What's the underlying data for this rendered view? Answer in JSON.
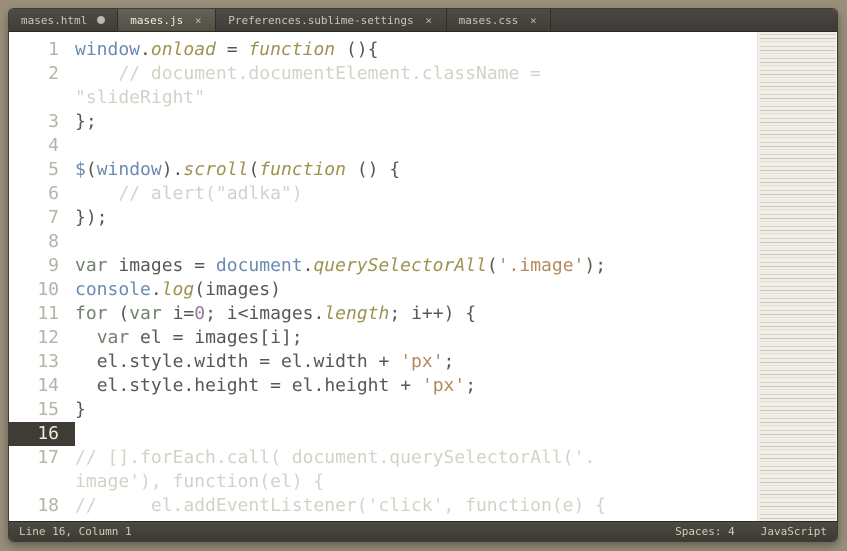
{
  "tabs": [
    {
      "label": "mases.html",
      "dirty": true,
      "active": false
    },
    {
      "label": "mases.js",
      "dirty": false,
      "active": true
    },
    {
      "label": "Preferences.sublime-settings",
      "dirty": false,
      "active": false
    },
    {
      "label": "mases.css",
      "dirty": false,
      "active": false
    }
  ],
  "active_line": 16,
  "status": {
    "left": "Line 16, Column 1",
    "spaces": "Spaces: 4",
    "syntax": "JavaScript"
  },
  "code": {
    "lines": [
      {
        "n": 1,
        "tokens": [
          [
            "c-builtin",
            "window"
          ],
          [
            "c-op",
            "."
          ],
          [
            "c-func",
            "onload"
          ],
          [
            "c-op",
            " = "
          ],
          [
            "c-func",
            "function"
          ],
          [
            "c-op",
            " "
          ],
          [
            "c-op",
            "()"
          ],
          [
            "c-op",
            "{"
          ]
        ]
      },
      {
        "n": 2,
        "tokens": [
          [
            "c-op",
            "    "
          ],
          [
            "c-dim",
            "// document.documentElement.className = "
          ]
        ],
        "wrap": [
          [
            "c-dim",
            "\"slideRight\""
          ]
        ]
      },
      {
        "n": 3,
        "tokens": [
          [
            "c-op",
            "};"
          ]
        ]
      },
      {
        "n": 4,
        "tokens": [
          [
            "c-op",
            ""
          ]
        ]
      },
      {
        "n": 5,
        "tokens": [
          [
            "c-builtin",
            "$"
          ],
          [
            "c-op",
            "("
          ],
          [
            "c-builtin",
            "window"
          ],
          [
            "c-op",
            ")."
          ],
          [
            "c-func",
            "scroll"
          ],
          [
            "c-op",
            "("
          ],
          [
            "c-func",
            "function"
          ],
          [
            "c-op",
            " () {"
          ]
        ]
      },
      {
        "n": 6,
        "tokens": [
          [
            "c-op",
            "    "
          ],
          [
            "c-dim",
            "// alert(\"adlka\")"
          ]
        ]
      },
      {
        "n": 7,
        "tokens": [
          [
            "c-op",
            "});"
          ]
        ]
      },
      {
        "n": 8,
        "tokens": [
          [
            "c-op",
            ""
          ]
        ]
      },
      {
        "n": 9,
        "tokens": [
          [
            "c-key",
            "var"
          ],
          [
            "c-op",
            " "
          ],
          [
            "c-ident",
            "images"
          ],
          [
            "c-op",
            " = "
          ],
          [
            "c-builtin",
            "document"
          ],
          [
            "c-op",
            "."
          ],
          [
            "c-func",
            "querySelectorAll"
          ],
          [
            "c-op",
            "("
          ],
          [
            "c-str",
            "'.image'"
          ],
          [
            "c-op",
            ");"
          ]
        ]
      },
      {
        "n": 10,
        "tokens": [
          [
            "c-builtin",
            "console"
          ],
          [
            "c-op",
            "."
          ],
          [
            "c-func",
            "log"
          ],
          [
            "c-op",
            "("
          ],
          [
            "c-ident",
            "images"
          ],
          [
            "c-op",
            ")"
          ]
        ]
      },
      {
        "n": 11,
        "tokens": [
          [
            "c-key",
            "for"
          ],
          [
            "c-op",
            " ("
          ],
          [
            "c-key",
            "var"
          ],
          [
            "c-op",
            " "
          ],
          [
            "c-ident",
            "i"
          ],
          [
            "c-op",
            "="
          ],
          [
            "c-num",
            "0"
          ],
          [
            "c-op",
            "; "
          ],
          [
            "c-ident",
            "i"
          ],
          [
            "c-op",
            "<"
          ],
          [
            "c-ident",
            "images"
          ],
          [
            "c-op",
            "."
          ],
          [
            "c-func",
            "length"
          ],
          [
            "c-op",
            "; "
          ],
          [
            "c-ident",
            "i"
          ],
          [
            "c-op",
            "++"
          ],
          [
            "c-op",
            ") {"
          ]
        ]
      },
      {
        "n": 12,
        "tokens": [
          [
            "c-op",
            "  "
          ],
          [
            "c-key",
            "var"
          ],
          [
            "c-op",
            " "
          ],
          [
            "c-ident",
            "el"
          ],
          [
            "c-op",
            " = "
          ],
          [
            "c-ident",
            "images"
          ],
          [
            "c-op",
            "["
          ],
          [
            "c-ident",
            "i"
          ],
          [
            "c-op",
            "];"
          ]
        ]
      },
      {
        "n": 13,
        "tokens": [
          [
            "c-op",
            "  "
          ],
          [
            "c-ident",
            "el"
          ],
          [
            "c-op",
            "."
          ],
          [
            "c-ident",
            "style"
          ],
          [
            "c-op",
            "."
          ],
          [
            "c-ident",
            "width"
          ],
          [
            "c-op",
            " = "
          ],
          [
            "c-ident",
            "el"
          ],
          [
            "c-op",
            "."
          ],
          [
            "c-ident",
            "width"
          ],
          [
            "c-op",
            " + "
          ],
          [
            "c-str",
            "'px'"
          ],
          [
            "c-op",
            ";"
          ]
        ]
      },
      {
        "n": 14,
        "tokens": [
          [
            "c-op",
            "  "
          ],
          [
            "c-ident",
            "el"
          ],
          [
            "c-op",
            "."
          ],
          [
            "c-ident",
            "style"
          ],
          [
            "c-op",
            "."
          ],
          [
            "c-ident",
            "height"
          ],
          [
            "c-op",
            " = "
          ],
          [
            "c-ident",
            "el"
          ],
          [
            "c-op",
            "."
          ],
          [
            "c-ident",
            "height"
          ],
          [
            "c-op",
            " + "
          ],
          [
            "c-str",
            "'px'"
          ],
          [
            "c-op",
            ";"
          ]
        ]
      },
      {
        "n": 15,
        "tokens": [
          [
            "c-op",
            "}"
          ]
        ]
      },
      {
        "n": 16,
        "tokens": [
          [
            "c-op",
            ""
          ]
        ]
      },
      {
        "n": 17,
        "tokens": [
          [
            "c-dim",
            "// [].forEach.call( document.querySelectorAll('."
          ]
        ],
        "wrap": [
          [
            "c-dim",
            "image'), function(el) {"
          ]
        ]
      },
      {
        "n": 18,
        "tokens": [
          [
            "c-dim",
            "//     el.addEventListener('click', function(e) {"
          ]
        ]
      }
    ]
  }
}
